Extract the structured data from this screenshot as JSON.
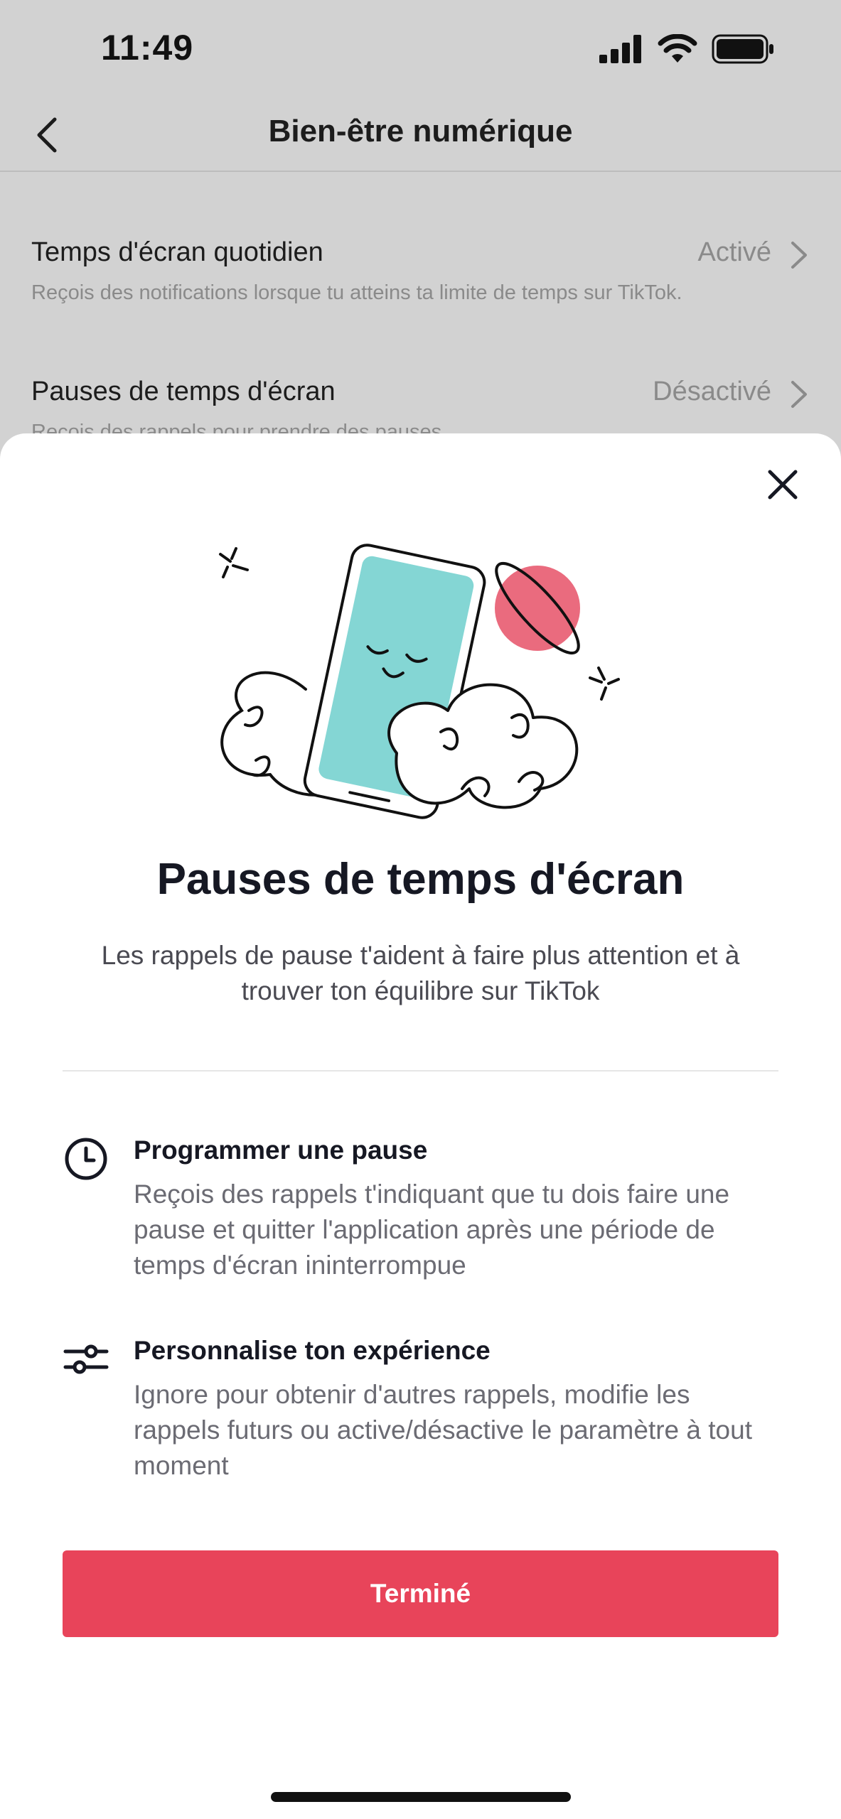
{
  "status_bar": {
    "time": "11:49"
  },
  "header": {
    "title": "Bien-être numérique"
  },
  "settings": [
    {
      "title": "Temps d'écran quotidien",
      "status": "Activé",
      "description": "Reçois des notifications lorsque tu atteins ta limite de temps sur TikTok."
    },
    {
      "title": "Pauses de temps d'écran",
      "status": "Désactivé",
      "description": "Reçois des rappels pour prendre des pauses."
    }
  ],
  "sheet": {
    "title": "Pauses de temps d'écran",
    "subtitle": "Les rappels de pause t'aident à faire plus attention et à trouver ton équilibre sur TikTok",
    "features": [
      {
        "icon": "clock-icon",
        "title": "Programmer une pause",
        "description": "Reçois des rappels t'indiquant que tu dois faire une pause et quitter l'application après une période de temps d'écran ininterrompue"
      },
      {
        "icon": "sliders-icon",
        "title": "Personnalise ton expérience",
        "description": "Ignore pour obtenir d'autres rappels, modifie les rappels futurs ou active/désactive le paramètre à tout moment"
      }
    ],
    "done_label": "Terminé"
  },
  "colors": {
    "accent": "#e8445a",
    "illustration_phone": "#84d6d4",
    "illustration_planet": "#ea6b7e",
    "dim_background": "#d2d2d2"
  }
}
